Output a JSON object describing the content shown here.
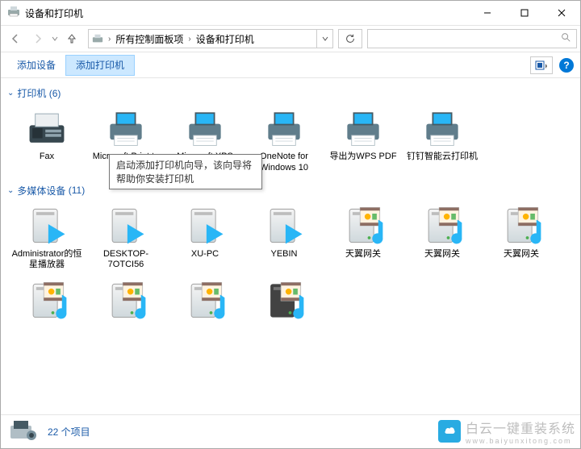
{
  "window": {
    "title": "设备和打印机"
  },
  "titlebar_controls": {
    "min": "–",
    "max": "▢",
    "close": "✕"
  },
  "breadcrumb": {
    "root": "所有控制面板项",
    "leaf": "设备和打印机"
  },
  "toolbar": {
    "add_device": "添加设备",
    "add_printer": "添加打印机"
  },
  "tooltip": "启动添加打印机向导，该向导将帮助你安装打印机",
  "groups": {
    "printers": {
      "label": "打印机",
      "count": "(6)"
    },
    "media": {
      "label": "多媒体设备",
      "count": "(11)"
    }
  },
  "printers": [
    {
      "label": "Fax",
      "icon": "fax"
    },
    {
      "label": "Microsoft Print to PDF",
      "icon": "printer"
    },
    {
      "label": "Microsoft XPS Document Writer",
      "icon": "printer"
    },
    {
      "label": "OneNote for Windows 10",
      "icon": "printer"
    },
    {
      "label": "导出为WPS PDF",
      "icon": "printer"
    },
    {
      "label": "钉钉智能云打印机",
      "icon": "printer"
    }
  ],
  "media_row1": [
    {
      "label": "Administrator的恒星播放器",
      "icon": "server-play"
    },
    {
      "label": "DESKTOP-7OTCI56",
      "icon": "server-play"
    },
    {
      "label": "XU-PC",
      "icon": "server-play"
    },
    {
      "label": "YEBIN",
      "icon": "server-play"
    },
    {
      "label": "天翼网关",
      "icon": "server-media"
    },
    {
      "label": "天翼网关",
      "icon": "server-media"
    },
    {
      "label": "天翼网关",
      "icon": "server-media"
    }
  ],
  "media_row2": [
    {
      "label": "",
      "icon": "server-media"
    },
    {
      "label": "",
      "icon": "server-media"
    },
    {
      "label": "",
      "icon": "server-media"
    },
    {
      "label": "",
      "icon": "server-media-dark"
    }
  ],
  "status": {
    "count": "22 个项目"
  },
  "watermark": {
    "text": "白云一键重装系统",
    "sub": "www.baiyunxitong.com"
  },
  "help": "?"
}
